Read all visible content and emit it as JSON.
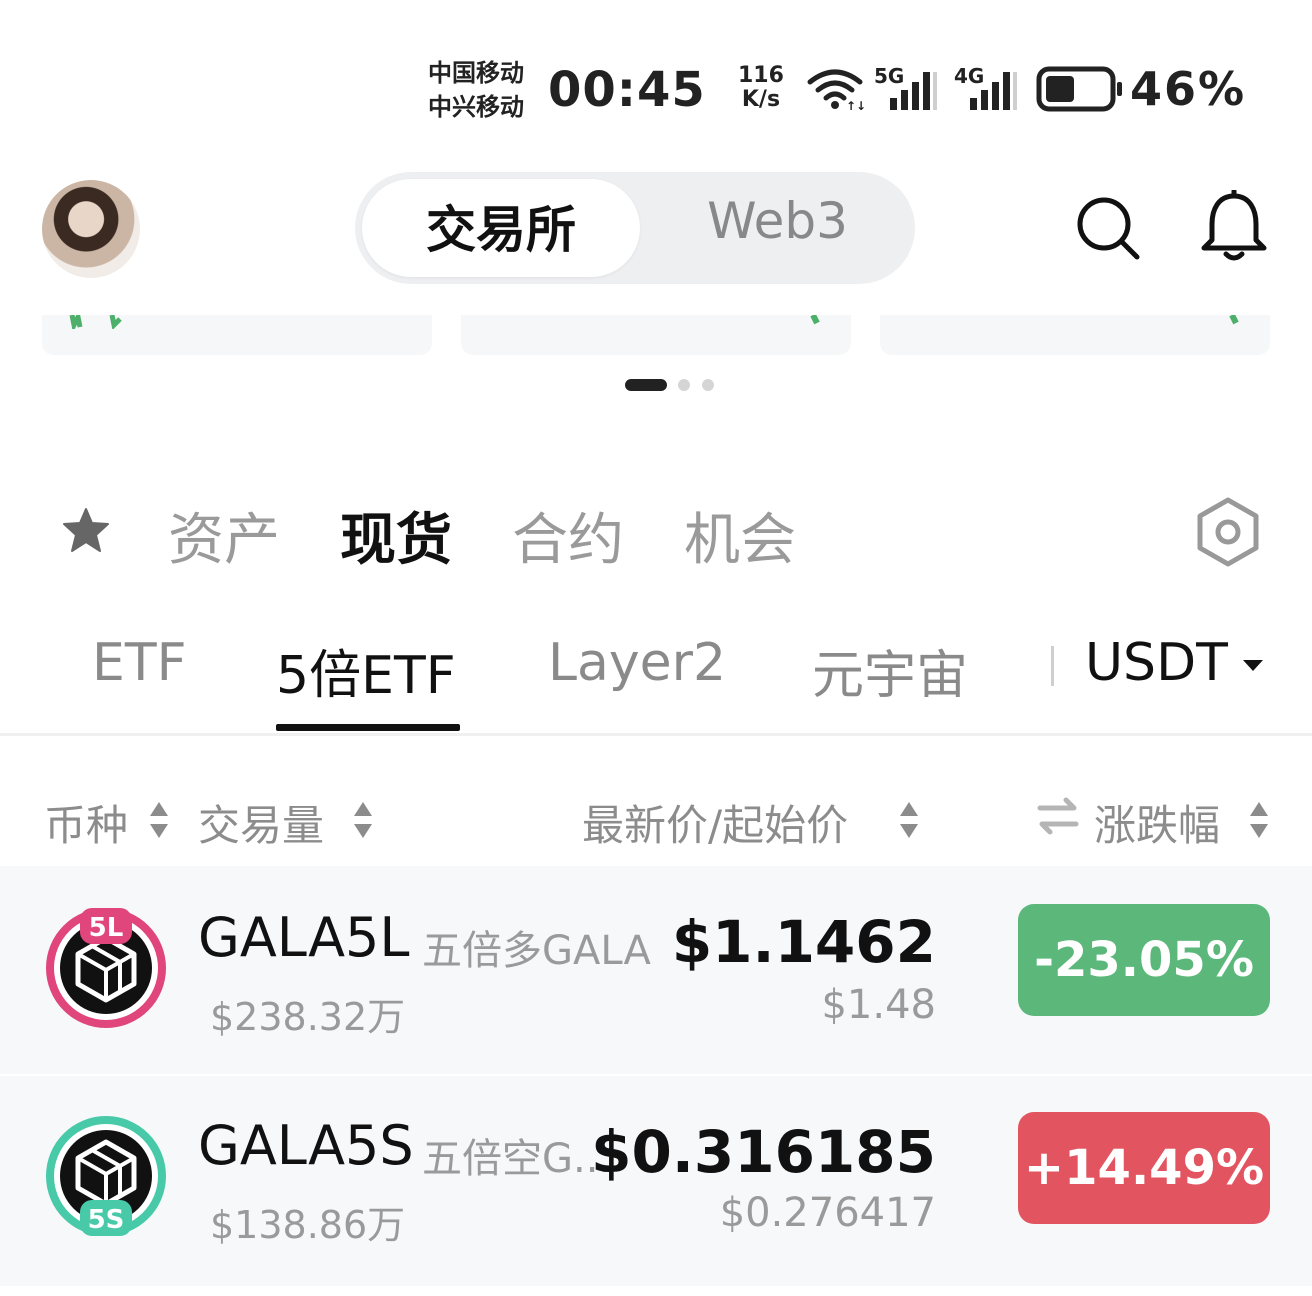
{
  "status_bar": {
    "carrier_1": "中国移动",
    "carrier_2": "中兴移动",
    "time": "00:45",
    "net_speed_value": "116",
    "net_speed_unit": "K/s",
    "signal_1": "5G",
    "signal_2": "4G",
    "battery_percent": "46%",
    "battery_level": 0.46
  },
  "header": {
    "segments": [
      "交易所",
      "Web3"
    ],
    "active_segment": "交易所"
  },
  "banner": {
    "pages": 3,
    "active_page": 1
  },
  "main_tabs": {
    "items": [
      "资产",
      "现货",
      "合约",
      "机会"
    ],
    "active": "现货"
  },
  "sub_tabs": {
    "items": [
      "ETF",
      "5倍ETF",
      "Layer2",
      "元宇宙"
    ],
    "active": "5倍ETF",
    "quote_currency": "USDT"
  },
  "columns": {
    "coin": "币种",
    "volume": "交易量",
    "price": "最新价/起始价",
    "change": "涨跌幅"
  },
  "rows": [
    {
      "badge_label": "5L",
      "symbol": "GALA5L",
      "description": "五倍多GALA",
      "volume": "$238.32万",
      "price": "$1.1462",
      "start_price": "$1.48",
      "change": "-23.05%",
      "change_color": "#5bb87a",
      "icon_ring_color": "#e0457b"
    },
    {
      "badge_label": "5S",
      "symbol": "GALA5S",
      "description": "五倍空G...",
      "volume": "$138.86万",
      "price": "$0.316185",
      "start_price": "$0.276417",
      "change": "+14.49%",
      "change_color": "#e2545f",
      "icon_ring_color": "#48c9a8"
    }
  ]
}
